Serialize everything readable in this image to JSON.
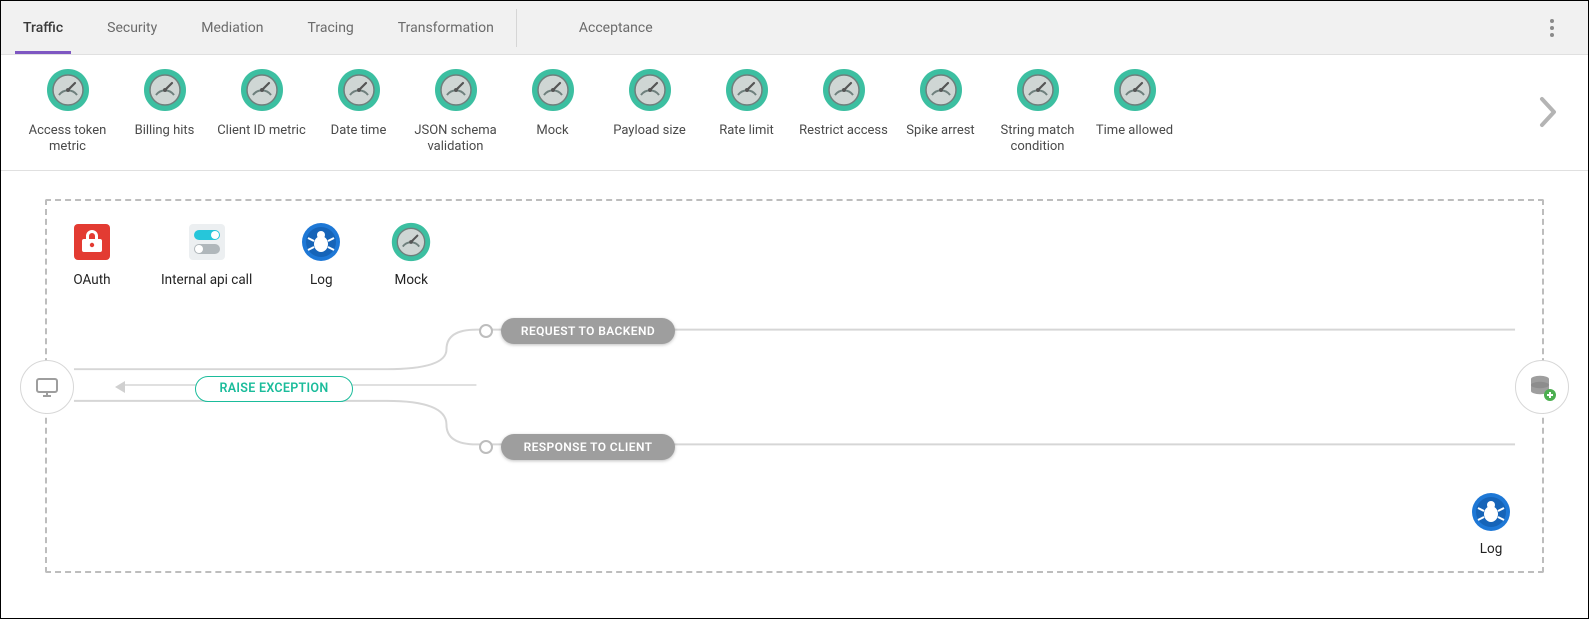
{
  "tabs": {
    "left": [
      {
        "label": "Traffic",
        "active": true
      },
      {
        "label": "Security",
        "active": false
      },
      {
        "label": "Mediation",
        "active": false
      },
      {
        "label": "Tracing",
        "active": false
      },
      {
        "label": "Transformation",
        "active": false
      }
    ],
    "right": [
      {
        "label": "Acceptance",
        "active": false
      }
    ]
  },
  "palette": [
    {
      "label": "Access token metric"
    },
    {
      "label": "Billing hits"
    },
    {
      "label": "Client ID metric"
    },
    {
      "label": "Date time"
    },
    {
      "label": "JSON schema validation"
    },
    {
      "label": "Mock"
    },
    {
      "label": "Payload size"
    },
    {
      "label": "Rate limit"
    },
    {
      "label": "Restrict access"
    },
    {
      "label": "Spike arrest"
    },
    {
      "label": "String match condition"
    },
    {
      "label": "Time allowed"
    }
  ],
  "flow": {
    "top_policies": [
      {
        "label": "OAuth",
        "icon": "oauth"
      },
      {
        "label": "Internal api call",
        "icon": "toggle"
      },
      {
        "label": "Log",
        "icon": "bug"
      },
      {
        "label": "Mock",
        "icon": "gauge"
      }
    ],
    "bottom_right_policy": {
      "label": "Log",
      "icon": "bug"
    },
    "pills": {
      "request_backend": "REQUEST TO BACKEND",
      "response_client": "RESPONSE TO CLIENT",
      "raise_exception": "RAISE EXCEPTION"
    }
  },
  "colors": {
    "accent_tab": "#7e57c2",
    "teal": "#1bbc9b",
    "gauge_stroke": "#38b597",
    "gauge_face": "#9bb0ad",
    "grey_pill": "#9e9e9e",
    "log_blue": "#1e88e5",
    "oauth_red": "#e53935"
  }
}
